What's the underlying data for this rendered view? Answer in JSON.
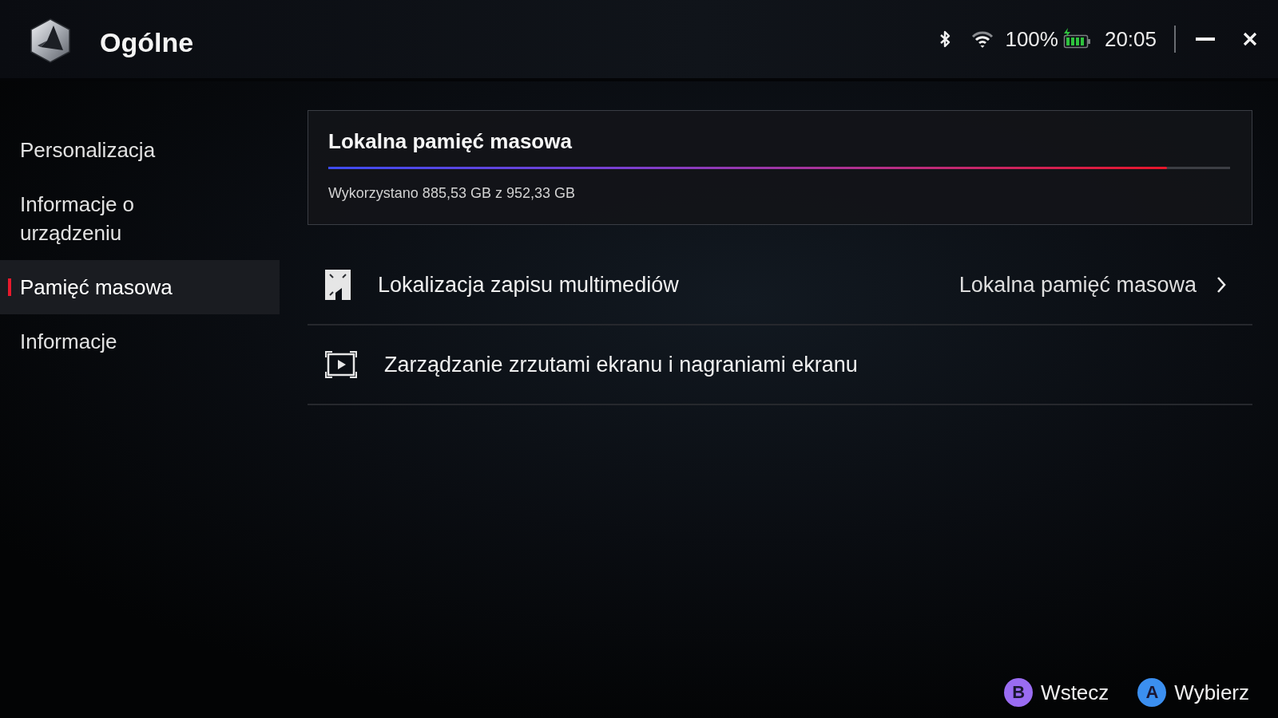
{
  "header": {
    "title": "Ogólne",
    "battery_percent": "100%",
    "time": "20:05"
  },
  "sidebar": {
    "items": [
      {
        "label": "Personalizacja",
        "selected": false
      },
      {
        "label": "Informacje o urządzeniu",
        "selected": false
      },
      {
        "label": "Pamięć masowa",
        "selected": true
      },
      {
        "label": "Informacje",
        "selected": false
      }
    ]
  },
  "storage_card": {
    "title": "Lokalna pamięć masowa",
    "level": 0.93,
    "usage": "Wykorzystano 885,53 GB z 952,33 GB"
  },
  "settings": [
    {
      "kind": "picker",
      "label": "Lokalizacja zapisu multimediów",
      "value": "Lokalna pamięć masowa"
    },
    {
      "kind": "page",
      "label": "Zarządzanie zrzutami ekranu i nagraniami ekranu"
    }
  ],
  "footer": {
    "hints": [
      {
        "key": "B",
        "label": "Wstecz",
        "color": "#9a6cf2"
      },
      {
        "key": "A",
        "label": "Wybierz",
        "color": "#3b8ff0"
      }
    ]
  }
}
